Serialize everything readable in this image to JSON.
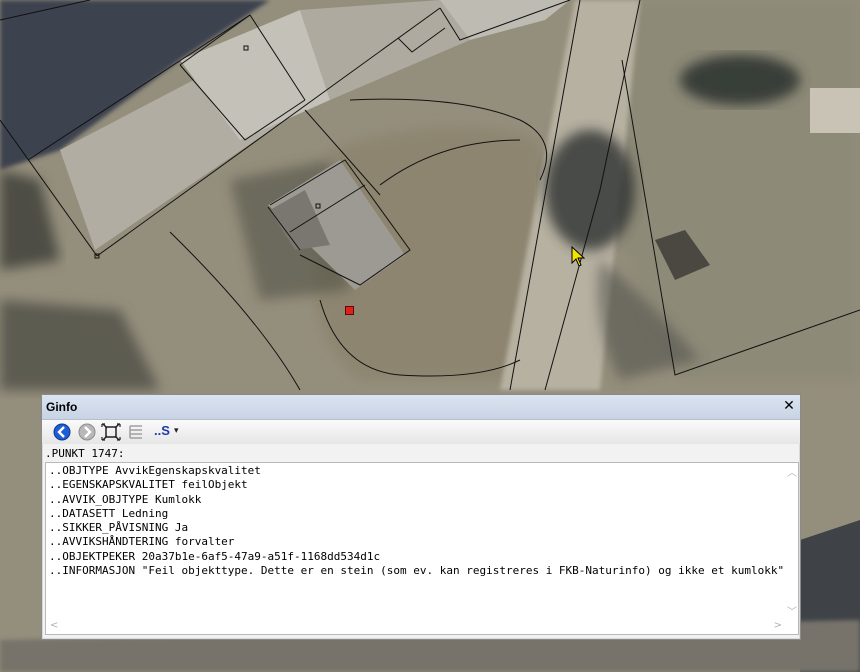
{
  "window": {
    "title": "Ginfo",
    "close_symbol": "✕"
  },
  "toolbar": {
    "buttons": [
      {
        "name": "back-icon"
      },
      {
        "name": "forward-icon"
      },
      {
        "name": "zoom-to-object-icon"
      },
      {
        "name": "list-icon"
      }
    ],
    "snum_label": "..S",
    "dropdown_symbol": "▾"
  },
  "header_line": ".PUNKT 1747:",
  "info_lines": [
    "..OBJTYPE AvvikEgenskapskvalitet",
    "..EGENSKAPSKVALITET feilObjekt",
    "..AVVIK_OBJTYPE Kumlokk",
    "..DATASETT Ledning",
    "..SIKKER_PÅVISNING Ja",
    "..AVVIKSHÅNDTERING forvalter",
    "..OBJEKTPEKER 20a37b1e-6af5-47a9-a51f-1168dd534d1c",
    "..INFORMASJON \"Feil objekttype. Dette er en stein (som ev. kan registreres i FKB-Naturinfo) og ikke et kumlokk\""
  ],
  "colors": {
    "point_marker": "#e0201a",
    "titlebar": "#ccd7e8",
    "cursor": "#f2e600"
  }
}
